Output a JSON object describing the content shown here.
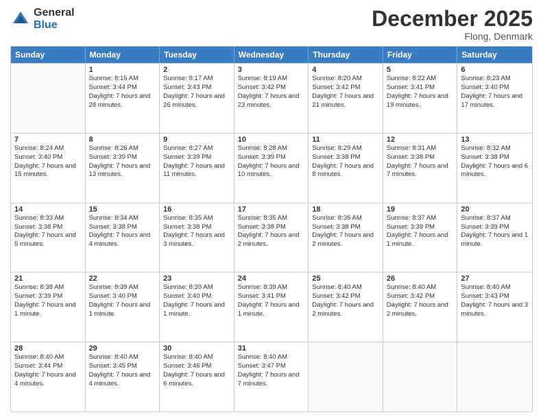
{
  "logo": {
    "general": "General",
    "blue": "Blue"
  },
  "header": {
    "month": "December 2025",
    "location": "Flong, Denmark"
  },
  "weekdays": [
    "Sunday",
    "Monday",
    "Tuesday",
    "Wednesday",
    "Thursday",
    "Friday",
    "Saturday"
  ],
  "rows": [
    [
      {
        "day": "",
        "sunrise": "",
        "sunset": "",
        "daylight": ""
      },
      {
        "day": "1",
        "sunrise": "Sunrise: 8:15 AM",
        "sunset": "Sunset: 3:44 PM",
        "daylight": "Daylight: 7 hours and 28 minutes."
      },
      {
        "day": "2",
        "sunrise": "Sunrise: 8:17 AM",
        "sunset": "Sunset: 3:43 PM",
        "daylight": "Daylight: 7 hours and 26 minutes."
      },
      {
        "day": "3",
        "sunrise": "Sunrise: 8:19 AM",
        "sunset": "Sunset: 3:42 PM",
        "daylight": "Daylight: 7 hours and 23 minutes."
      },
      {
        "day": "4",
        "sunrise": "Sunrise: 8:20 AM",
        "sunset": "Sunset: 3:42 PM",
        "daylight": "Daylight: 7 hours and 21 minutes."
      },
      {
        "day": "5",
        "sunrise": "Sunrise: 8:22 AM",
        "sunset": "Sunset: 3:41 PM",
        "daylight": "Daylight: 7 hours and 19 minutes."
      },
      {
        "day": "6",
        "sunrise": "Sunrise: 8:23 AM",
        "sunset": "Sunset: 3:40 PM",
        "daylight": "Daylight: 7 hours and 17 minutes."
      }
    ],
    [
      {
        "day": "7",
        "sunrise": "Sunrise: 8:24 AM",
        "sunset": "Sunset: 3:40 PM",
        "daylight": "Daylight: 7 hours and 15 minutes."
      },
      {
        "day": "8",
        "sunrise": "Sunrise: 8:26 AM",
        "sunset": "Sunset: 3:39 PM",
        "daylight": "Daylight: 7 hours and 13 minutes."
      },
      {
        "day": "9",
        "sunrise": "Sunrise: 8:27 AM",
        "sunset": "Sunset: 3:39 PM",
        "daylight": "Daylight: 7 hours and 11 minutes."
      },
      {
        "day": "10",
        "sunrise": "Sunrise: 8:28 AM",
        "sunset": "Sunset: 3:39 PM",
        "daylight": "Daylight: 7 hours and 10 minutes."
      },
      {
        "day": "11",
        "sunrise": "Sunrise: 8:29 AM",
        "sunset": "Sunset: 3:38 PM",
        "daylight": "Daylight: 7 hours and 8 minutes."
      },
      {
        "day": "12",
        "sunrise": "Sunrise: 8:31 AM",
        "sunset": "Sunset: 3:38 PM",
        "daylight": "Daylight: 7 hours and 7 minutes."
      },
      {
        "day": "13",
        "sunrise": "Sunrise: 8:32 AM",
        "sunset": "Sunset: 3:38 PM",
        "daylight": "Daylight: 7 hours and 6 minutes."
      }
    ],
    [
      {
        "day": "14",
        "sunrise": "Sunrise: 8:33 AM",
        "sunset": "Sunset: 3:38 PM",
        "daylight": "Daylight: 7 hours and 5 minutes."
      },
      {
        "day": "15",
        "sunrise": "Sunrise: 8:34 AM",
        "sunset": "Sunset: 3:38 PM",
        "daylight": "Daylight: 7 hours and 4 minutes."
      },
      {
        "day": "16",
        "sunrise": "Sunrise: 8:35 AM",
        "sunset": "Sunset: 3:38 PM",
        "daylight": "Daylight: 7 hours and 3 minutes."
      },
      {
        "day": "17",
        "sunrise": "Sunrise: 8:35 AM",
        "sunset": "Sunset: 3:38 PM",
        "daylight": "Daylight: 7 hours and 2 minutes."
      },
      {
        "day": "18",
        "sunrise": "Sunrise: 8:36 AM",
        "sunset": "Sunset: 3:38 PM",
        "daylight": "Daylight: 7 hours and 2 minutes."
      },
      {
        "day": "19",
        "sunrise": "Sunrise: 8:37 AM",
        "sunset": "Sunset: 3:39 PM",
        "daylight": "Daylight: 7 hours and 1 minute."
      },
      {
        "day": "20",
        "sunrise": "Sunrise: 8:37 AM",
        "sunset": "Sunset: 3:39 PM",
        "daylight": "Daylight: 7 hours and 1 minute."
      }
    ],
    [
      {
        "day": "21",
        "sunrise": "Sunrise: 8:38 AM",
        "sunset": "Sunset: 3:39 PM",
        "daylight": "Daylight: 7 hours and 1 minute."
      },
      {
        "day": "22",
        "sunrise": "Sunrise: 8:39 AM",
        "sunset": "Sunset: 3:40 PM",
        "daylight": "Daylight: 7 hours and 1 minute."
      },
      {
        "day": "23",
        "sunrise": "Sunrise: 8:39 AM",
        "sunset": "Sunset: 3:40 PM",
        "daylight": "Daylight: 7 hours and 1 minute."
      },
      {
        "day": "24",
        "sunrise": "Sunrise: 8:39 AM",
        "sunset": "Sunset: 3:41 PM",
        "daylight": "Daylight: 7 hours and 1 minute."
      },
      {
        "day": "25",
        "sunrise": "Sunrise: 8:40 AM",
        "sunset": "Sunset: 3:42 PM",
        "daylight": "Daylight: 7 hours and 2 minutes."
      },
      {
        "day": "26",
        "sunrise": "Sunrise: 8:40 AM",
        "sunset": "Sunset: 3:42 PM",
        "daylight": "Daylight: 7 hours and 2 minutes."
      },
      {
        "day": "27",
        "sunrise": "Sunrise: 8:40 AM",
        "sunset": "Sunset: 3:43 PM",
        "daylight": "Daylight: 7 hours and 3 minutes."
      }
    ],
    [
      {
        "day": "28",
        "sunrise": "Sunrise: 8:40 AM",
        "sunset": "Sunset: 3:44 PM",
        "daylight": "Daylight: 7 hours and 4 minutes."
      },
      {
        "day": "29",
        "sunrise": "Sunrise: 8:40 AM",
        "sunset": "Sunset: 3:45 PM",
        "daylight": "Daylight: 7 hours and 4 minutes."
      },
      {
        "day": "30",
        "sunrise": "Sunrise: 8:40 AM",
        "sunset": "Sunset: 3:46 PM",
        "daylight": "Daylight: 7 hours and 6 minutes."
      },
      {
        "day": "31",
        "sunrise": "Sunrise: 8:40 AM",
        "sunset": "Sunset: 3:47 PM",
        "daylight": "Daylight: 7 hours and 7 minutes."
      },
      {
        "day": "",
        "sunrise": "",
        "sunset": "",
        "daylight": ""
      },
      {
        "day": "",
        "sunrise": "",
        "sunset": "",
        "daylight": ""
      },
      {
        "day": "",
        "sunrise": "",
        "sunset": "",
        "daylight": ""
      }
    ]
  ]
}
